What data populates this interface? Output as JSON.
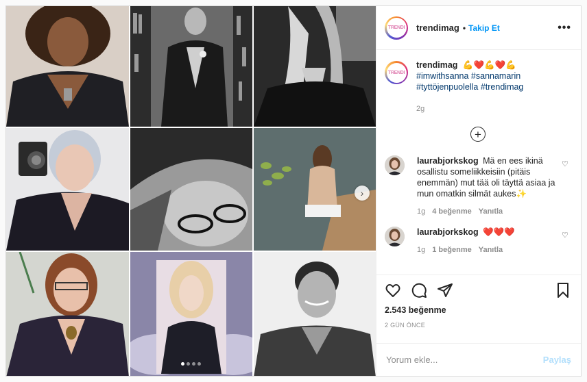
{
  "account": {
    "username": "trendimag",
    "avatar_text": "TRENDI",
    "follow_label": "Takip Et",
    "separator": "•"
  },
  "caption": {
    "username": "trendimag",
    "emojis": "💪❤️💪❤️💪",
    "hashtags": [
      "#imwithsanna",
      "#sannamarin",
      "#tyttöjenpuolella",
      "#trendimag"
    ],
    "time": "2g"
  },
  "comments": [
    {
      "username": "laurabjorkskog",
      "text": "Mä en ees ikinä osallistu someliikkeisiin (pitäis enemmän) mut tää oli täyttä asiaa ja mun omatkin silmät aukes✨",
      "time": "1g",
      "likes": "4 beğenme",
      "reply": "Yanıtla"
    },
    {
      "username": "laurabjorkskog",
      "text": "❤️❤️❤️",
      "time": "1g",
      "likes": "1 beğenme",
      "reply": "Yanıtla"
    }
  ],
  "likes_count": "2.543 beğenme",
  "posted_ago": "2 GÜN ÖNCE",
  "comment_box": {
    "placeholder": "Yorum ekle...",
    "post_label": "Paylaş"
  },
  "carousel": {
    "slides": 4,
    "active": 0
  },
  "colors": {
    "link_blue": "#0095f6",
    "hashtag": "#00376b",
    "muted": "#8e8e8e"
  }
}
